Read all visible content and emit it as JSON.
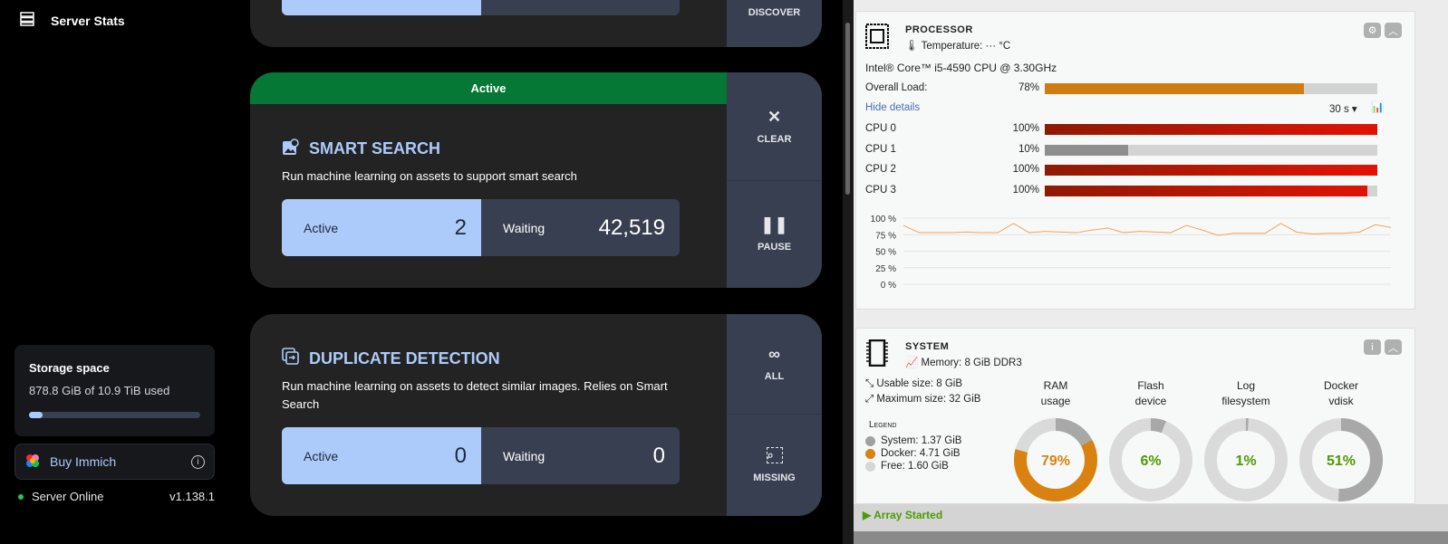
{
  "sidebar": {
    "title": "Server Stats",
    "storage": {
      "title": "Storage space",
      "usage": "878.8 GiB of 10.9 TiB used",
      "used_fraction": 0.079
    },
    "buy": "Buy Immich",
    "status": "Server Online",
    "version": "v1.138.1"
  },
  "jobs": [
    {
      "side_buttons": [
        "DISCOVER"
      ]
    },
    {
      "banner": "Active",
      "title": "SMART SEARCH",
      "description": "Run machine learning on assets to support smart search",
      "active_label": "Active",
      "active": "2",
      "waiting_label": "Waiting",
      "waiting": "42,519",
      "side_buttons": [
        "CLEAR",
        "PAUSE"
      ]
    },
    {
      "title": "DUPLICATE DETECTION",
      "description": "Run machine learning on assets to detect similar images. Relies on Smart Search",
      "active_label": "Active",
      "active": "0",
      "waiting_label": "Waiting",
      "waiting": "0",
      "side_buttons": [
        "ALL",
        "MISSING"
      ]
    }
  ],
  "processor": {
    "title": "PROCESSOR",
    "temperature": "Temperature: ··· °C",
    "model": "Intel® Core™ i5-4590 CPU @ 3.30GHz",
    "overall_label": "Overall Load:",
    "overall": "78%",
    "overall_value": 78,
    "hide_details": "Hide details",
    "interval": "30 s ▾",
    "cpus": [
      {
        "label": "CPU 0",
        "pct": "100%",
        "value": 100
      },
      {
        "label": "CPU 1",
        "pct": "10%",
        "value": 25
      },
      {
        "label": "CPU 2",
        "pct": "100%",
        "value": 100
      },
      {
        "label": "CPU 3",
        "pct": "100%",
        "value": 97
      }
    ]
  },
  "chart_data": {
    "type": "line",
    "ylim": [
      0,
      100
    ],
    "yticks": [
      "100 %",
      "75 %",
      "50 %",
      "25 %",
      "0 %"
    ],
    "series": [
      {
        "name": "CPU load",
        "color": "#f5a35c",
        "values": [
          89,
          78,
          78,
          78,
          79,
          78,
          78,
          92,
          78,
          80,
          79,
          78,
          82,
          85,
          78,
          80,
          79,
          78,
          89,
          82,
          74,
          77,
          77,
          77,
          92,
          79,
          76,
          77,
          77,
          79,
          90,
          86
        ]
      }
    ]
  },
  "system": {
    "title": "SYSTEM",
    "memory": "Memory: 8 GiB DDR3",
    "usable": "Usable size: 8 GiB",
    "maximum": "Maximum size: 32 GiB",
    "legend_title": "Legend",
    "legend": [
      {
        "label": "System: 1.37 GiB",
        "color": "#a0a0a0"
      },
      {
        "label": "Docker: 4.71 GiB",
        "color": "#d9820f"
      },
      {
        "label": "Free: 1.60 GiB",
        "color": "#d6d6d6"
      }
    ],
    "donuts": [
      {
        "label1": "RAM",
        "label2": "usage",
        "pct": "79%",
        "segments": [
          {
            "v": 17,
            "c": "#a8a8a8"
          },
          {
            "v": 62,
            "c": "#d9820f"
          }
        ],
        "text_color": "#d9820f"
      },
      {
        "label1": "Flash",
        "label2": "device",
        "pct": "6%",
        "segments": [
          {
            "v": 6,
            "c": "#a8a8a8"
          }
        ],
        "text_color": "#4e9a06"
      },
      {
        "label1": "Log",
        "label2": "filesystem",
        "pct": "1%",
        "segments": [
          {
            "v": 1,
            "c": "#a8a8a8"
          }
        ],
        "text_color": "#4e9a06"
      },
      {
        "label1": "Docker",
        "label2": "vdisk",
        "pct": "51%",
        "segments": [
          {
            "v": 51,
            "c": "#a8a8a8"
          }
        ],
        "text_color": "#4e9a06"
      }
    ]
  },
  "footer": {
    "array": "Array Started"
  }
}
